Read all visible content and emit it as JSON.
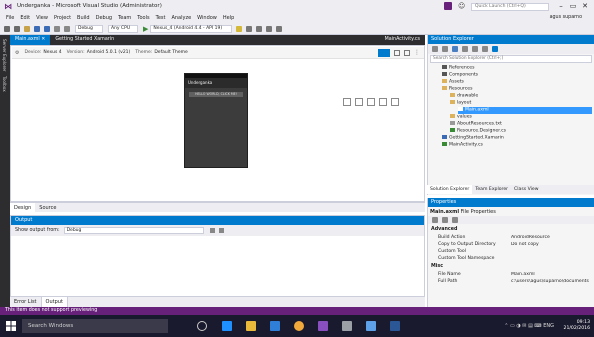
{
  "window": {
    "title": "Underganka - Microsoft Visual Studio (Administrator)",
    "quick_launch_placeholder": "Quick Launch (Ctrl+Q)",
    "user": "agus suparno"
  },
  "menu": [
    "File",
    "Edit",
    "View",
    "Project",
    "Build",
    "Debug",
    "Team",
    "Tools",
    "Test",
    "Analyze",
    "Window",
    "Help"
  ],
  "toolbar": {
    "config": "Debug",
    "platform": "Any CPU",
    "device": "Nexus_4 (Android 4.4 - API 19)"
  },
  "side_tabs": [
    "Server Explorer",
    "Toolbox"
  ],
  "doc_tabs": {
    "tabs": [
      "Main.axml",
      "Getting Started Xamarin"
    ],
    "right_tab": "MainActivity.cs"
  },
  "designer": {
    "device_label": "Device:",
    "device_value": "Nexus 4",
    "version_label": "Version:",
    "version_value": "Android 5.0.1 (v21)",
    "theme_label": "Theme:",
    "theme_value": "Default Theme",
    "phone_title": "Underganka",
    "phone_button": "HELLO WORLD, CLICK ME!"
  },
  "design_tabs": [
    "Design",
    "Source"
  ],
  "output": {
    "title": "Output",
    "show_label": "Show output from:",
    "show_value": "Debug"
  },
  "bottom_tabs": [
    "Error List",
    "Output"
  ],
  "solution_explorer": {
    "title": "Solution Explorer",
    "search_placeholder": "Search Solution Explorer (Ctrl+;)",
    "items": [
      {
        "label": "References",
        "level": 1
      },
      {
        "label": "Components",
        "level": 1
      },
      {
        "label": "Assets",
        "level": 1
      },
      {
        "label": "Resources",
        "level": 1
      },
      {
        "label": "drawable",
        "level": 2
      },
      {
        "label": "layout",
        "level": 2
      },
      {
        "label": "Main.axml",
        "level": 3,
        "selected": true
      },
      {
        "label": "values",
        "level": 2
      },
      {
        "label": "AboutResources.txt",
        "level": 2
      },
      {
        "label": "Resource.Designer.cs",
        "level": 2
      },
      {
        "label": "GettingStarted.Xamarin",
        "level": 1
      },
      {
        "label": "MainActivity.cs",
        "level": 1
      }
    ],
    "tabs": [
      "Solution Explorer",
      "Team Explorer",
      "Class View"
    ]
  },
  "properties": {
    "title": "Properties",
    "object": "Main.axml",
    "object_type": "File Properties",
    "categories": [
      {
        "name": "Advanced",
        "rows": [
          {
            "name": "Build Action",
            "value": "AndroidResource"
          },
          {
            "name": "Copy to Output Directory",
            "value": "Do not copy"
          },
          {
            "name": "Custom Tool",
            "value": ""
          },
          {
            "name": "Custom Tool Namespace",
            "value": ""
          }
        ]
      },
      {
        "name": "Misc",
        "rows": [
          {
            "name": "File Name",
            "value": "Main.axml"
          },
          {
            "name": "Full Path",
            "value": "c:\\users\\agus\\suparno\\documents"
          }
        ]
      }
    ]
  },
  "status": {
    "text": "This item does not support previewing"
  },
  "taskbar": {
    "search_placeholder": "Search Windows",
    "language": "ENG",
    "time": "09:13",
    "date": "21/02/2016"
  },
  "colors": {
    "accent": "#007acc",
    "status": "#68217a",
    "chrome": "#eeeef2"
  }
}
